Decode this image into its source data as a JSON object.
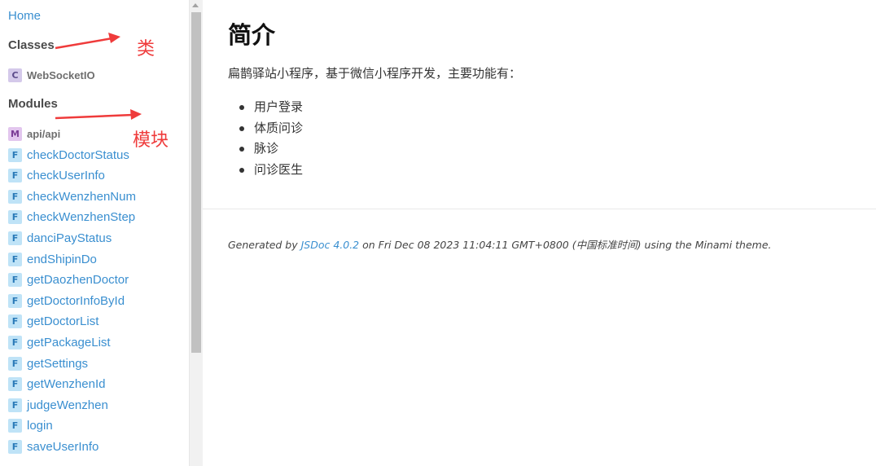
{
  "sidebar": {
    "home_label": "Home",
    "classes_heading": "Classes",
    "classes": [
      {
        "badge": "C",
        "label": "WebSocketIO"
      }
    ],
    "modules_heading": "Modules",
    "modules": [
      {
        "badge": "M",
        "label": "api/api"
      }
    ],
    "functions": [
      {
        "badge": "F",
        "label": "checkDoctorStatus"
      },
      {
        "badge": "F",
        "label": "checkUserInfo"
      },
      {
        "badge": "F",
        "label": "checkWenzhenNum"
      },
      {
        "badge": "F",
        "label": "checkWenzhenStep"
      },
      {
        "badge": "F",
        "label": "danciPayStatus"
      },
      {
        "badge": "F",
        "label": "endShipinDo"
      },
      {
        "badge": "F",
        "label": "getDaozhenDoctor"
      },
      {
        "badge": "F",
        "label": "getDoctorInfoById"
      },
      {
        "badge": "F",
        "label": "getDoctorList"
      },
      {
        "badge": "F",
        "label": "getPackageList"
      },
      {
        "badge": "F",
        "label": "getSettings"
      },
      {
        "badge": "F",
        "label": "getWenzhenId"
      },
      {
        "badge": "F",
        "label": "judgeWenzhen"
      },
      {
        "badge": "F",
        "label": "login"
      },
      {
        "badge": "F",
        "label": "saveUserInfo"
      }
    ]
  },
  "annotations": {
    "classes_note": "类",
    "modules_note": "模块",
    "arrow_color": "#ef3b3b"
  },
  "main": {
    "title": "简介",
    "intro": "扁鹊驿站小程序，基于微信小程序开发，主要功能有：",
    "features": [
      "用户登录",
      "体质问诊",
      "脉诊",
      "问诊医生"
    ]
  },
  "footer": {
    "prefix": "Generated by ",
    "link_label": "JSDoc 4.0.2",
    "suffix": " on Fri Dec 08 2023 11:04:11 GMT+0800 (中国标准时间) using the Minami theme."
  },
  "colors": {
    "link": "#3a8fd0",
    "badge_class_bg": "#d4c9ea",
    "badge_module_bg": "#e2c6ee",
    "badge_function_bg": "#bfe3f7"
  }
}
